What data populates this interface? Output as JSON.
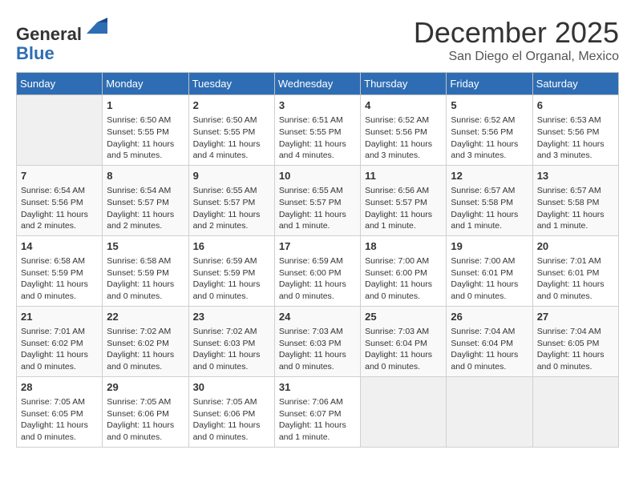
{
  "header": {
    "logo_line1": "General",
    "logo_line2": "Blue",
    "month": "December 2025",
    "location": "San Diego el Organal, Mexico"
  },
  "days_of_week": [
    "Sunday",
    "Monday",
    "Tuesday",
    "Wednesday",
    "Thursday",
    "Friday",
    "Saturday"
  ],
  "weeks": [
    [
      {
        "day": "",
        "info": ""
      },
      {
        "day": "1",
        "info": "Sunrise: 6:50 AM\nSunset: 5:55 PM\nDaylight: 11 hours\nand 5 minutes."
      },
      {
        "day": "2",
        "info": "Sunrise: 6:50 AM\nSunset: 5:55 PM\nDaylight: 11 hours\nand 4 minutes."
      },
      {
        "day": "3",
        "info": "Sunrise: 6:51 AM\nSunset: 5:55 PM\nDaylight: 11 hours\nand 4 minutes."
      },
      {
        "day": "4",
        "info": "Sunrise: 6:52 AM\nSunset: 5:56 PM\nDaylight: 11 hours\nand 3 minutes."
      },
      {
        "day": "5",
        "info": "Sunrise: 6:52 AM\nSunset: 5:56 PM\nDaylight: 11 hours\nand 3 minutes."
      },
      {
        "day": "6",
        "info": "Sunrise: 6:53 AM\nSunset: 5:56 PM\nDaylight: 11 hours\nand 3 minutes."
      }
    ],
    [
      {
        "day": "7",
        "info": "Sunrise: 6:54 AM\nSunset: 5:56 PM\nDaylight: 11 hours\nand 2 minutes."
      },
      {
        "day": "8",
        "info": "Sunrise: 6:54 AM\nSunset: 5:57 PM\nDaylight: 11 hours\nand 2 minutes."
      },
      {
        "day": "9",
        "info": "Sunrise: 6:55 AM\nSunset: 5:57 PM\nDaylight: 11 hours\nand 2 minutes."
      },
      {
        "day": "10",
        "info": "Sunrise: 6:55 AM\nSunset: 5:57 PM\nDaylight: 11 hours\nand 1 minute."
      },
      {
        "day": "11",
        "info": "Sunrise: 6:56 AM\nSunset: 5:57 PM\nDaylight: 11 hours\nand 1 minute."
      },
      {
        "day": "12",
        "info": "Sunrise: 6:57 AM\nSunset: 5:58 PM\nDaylight: 11 hours\nand 1 minute."
      },
      {
        "day": "13",
        "info": "Sunrise: 6:57 AM\nSunset: 5:58 PM\nDaylight: 11 hours\nand 1 minute."
      }
    ],
    [
      {
        "day": "14",
        "info": "Sunrise: 6:58 AM\nSunset: 5:59 PM\nDaylight: 11 hours\nand 0 minutes."
      },
      {
        "day": "15",
        "info": "Sunrise: 6:58 AM\nSunset: 5:59 PM\nDaylight: 11 hours\nand 0 minutes."
      },
      {
        "day": "16",
        "info": "Sunrise: 6:59 AM\nSunset: 5:59 PM\nDaylight: 11 hours\nand 0 minutes."
      },
      {
        "day": "17",
        "info": "Sunrise: 6:59 AM\nSunset: 6:00 PM\nDaylight: 11 hours\nand 0 minutes."
      },
      {
        "day": "18",
        "info": "Sunrise: 7:00 AM\nSunset: 6:00 PM\nDaylight: 11 hours\nand 0 minutes."
      },
      {
        "day": "19",
        "info": "Sunrise: 7:00 AM\nSunset: 6:01 PM\nDaylight: 11 hours\nand 0 minutes."
      },
      {
        "day": "20",
        "info": "Sunrise: 7:01 AM\nSunset: 6:01 PM\nDaylight: 11 hours\nand 0 minutes."
      }
    ],
    [
      {
        "day": "21",
        "info": "Sunrise: 7:01 AM\nSunset: 6:02 PM\nDaylight: 11 hours\nand 0 minutes."
      },
      {
        "day": "22",
        "info": "Sunrise: 7:02 AM\nSunset: 6:02 PM\nDaylight: 11 hours\nand 0 minutes."
      },
      {
        "day": "23",
        "info": "Sunrise: 7:02 AM\nSunset: 6:03 PM\nDaylight: 11 hours\nand 0 minutes."
      },
      {
        "day": "24",
        "info": "Sunrise: 7:03 AM\nSunset: 6:03 PM\nDaylight: 11 hours\nand 0 minutes."
      },
      {
        "day": "25",
        "info": "Sunrise: 7:03 AM\nSunset: 6:04 PM\nDaylight: 11 hours\nand 0 minutes."
      },
      {
        "day": "26",
        "info": "Sunrise: 7:04 AM\nSunset: 6:04 PM\nDaylight: 11 hours\nand 0 minutes."
      },
      {
        "day": "27",
        "info": "Sunrise: 7:04 AM\nSunset: 6:05 PM\nDaylight: 11 hours\nand 0 minutes."
      }
    ],
    [
      {
        "day": "28",
        "info": "Sunrise: 7:05 AM\nSunset: 6:05 PM\nDaylight: 11 hours\nand 0 minutes."
      },
      {
        "day": "29",
        "info": "Sunrise: 7:05 AM\nSunset: 6:06 PM\nDaylight: 11 hours\nand 0 minutes."
      },
      {
        "day": "30",
        "info": "Sunrise: 7:05 AM\nSunset: 6:06 PM\nDaylight: 11 hours\nand 0 minutes."
      },
      {
        "day": "31",
        "info": "Sunrise: 7:06 AM\nSunset: 6:07 PM\nDaylight: 11 hours\nand 1 minute."
      },
      {
        "day": "",
        "info": ""
      },
      {
        "day": "",
        "info": ""
      },
      {
        "day": "",
        "info": ""
      }
    ]
  ]
}
